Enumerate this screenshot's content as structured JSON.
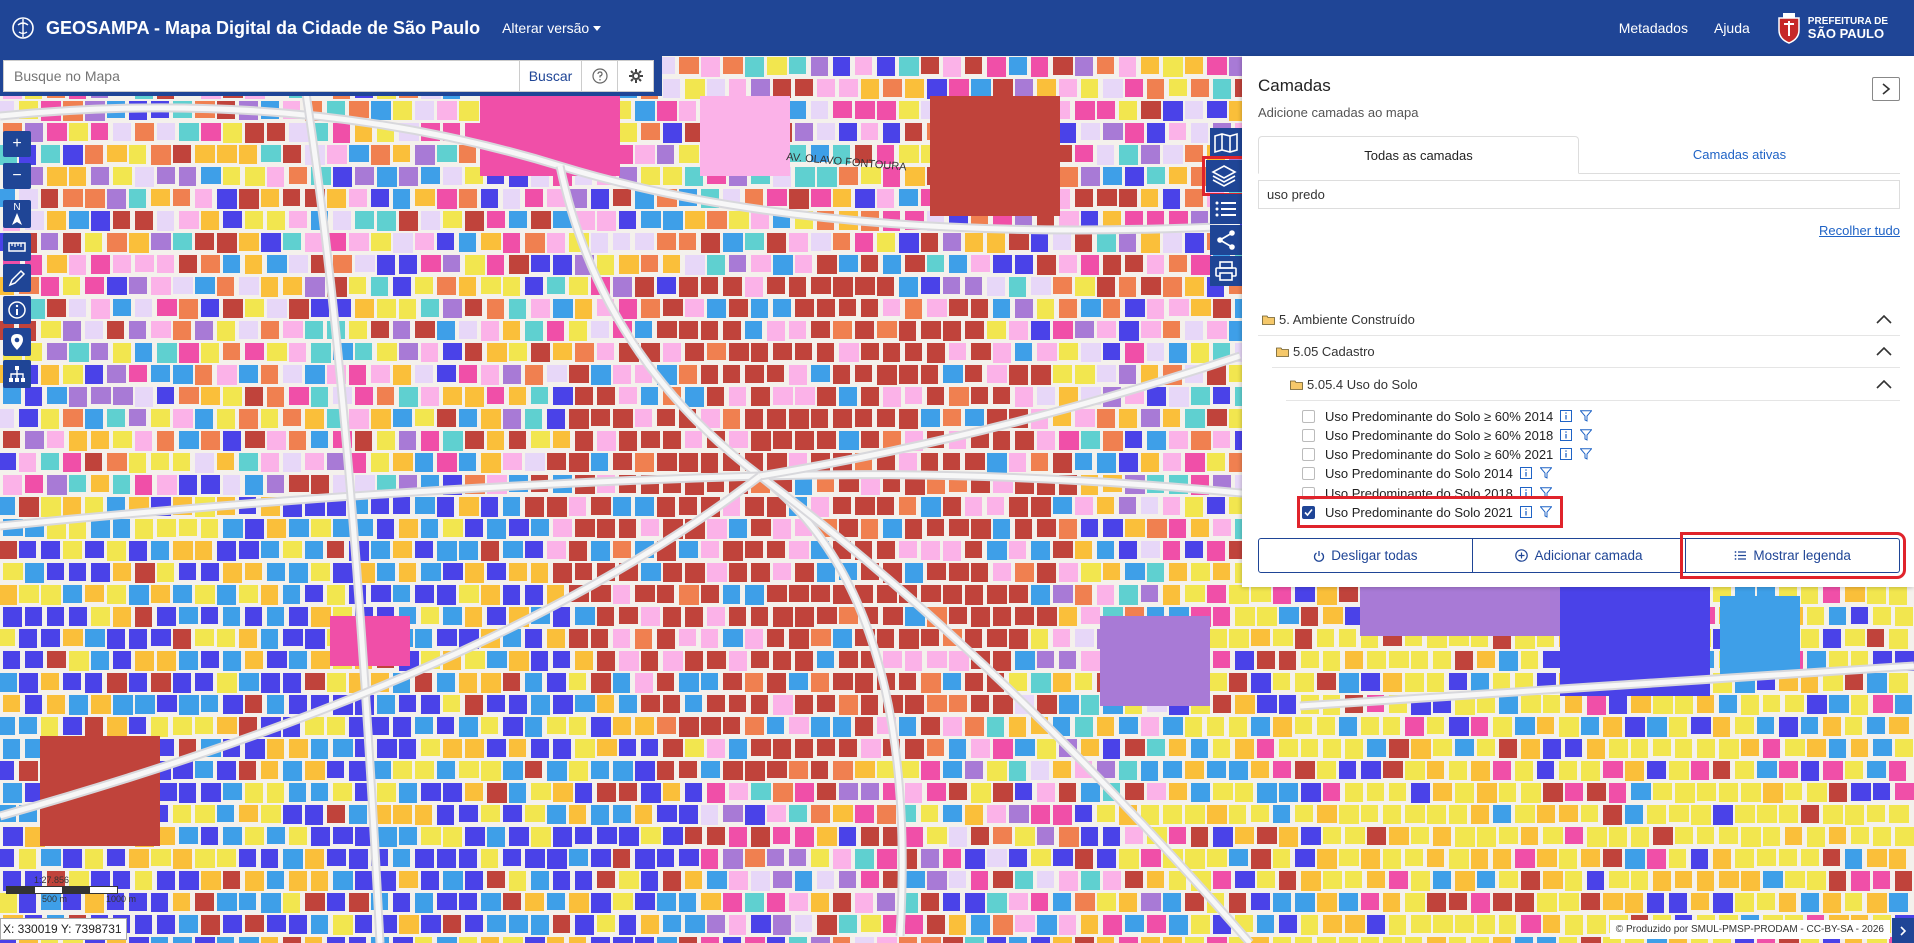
{
  "header": {
    "title": "GEOSAMPA - Mapa Digital da Cidade de São Paulo",
    "version_label": "Alterar versão",
    "nav": [
      "Metadados",
      "Ajuda"
    ],
    "prefeitura_line1": "PREFEITURA DE",
    "prefeitura_line2": "SÃO PAULO"
  },
  "search": {
    "placeholder": "Busque no Mapa",
    "button_label": "Buscar"
  },
  "map_tools": {
    "zoom_in": "+",
    "zoom_out": "−",
    "north": "N"
  },
  "map_labels": [
    "AV. OLAVO FONTOURA"
  ],
  "panel": {
    "title": "Camadas",
    "subtitle": "Adicione camadas ao mapa",
    "tabs": [
      "Todas as camadas",
      "Camadas ativas"
    ],
    "filter_value": "uso predo",
    "collapse_all": "Recolher tudo",
    "tree": [
      {
        "label": "5. Ambiente Construído"
      },
      {
        "label": "5.05 Cadastro"
      },
      {
        "label": "5.05.4 Uso do Solo"
      }
    ],
    "layers": [
      {
        "label": "Uso Predominante do Solo ≥ 60% 2014",
        "checked": false
      },
      {
        "label": "Uso Predominante do Solo ≥ 60% 2018",
        "checked": false
      },
      {
        "label": "Uso Predominante do Solo ≥ 60% 2021",
        "checked": false
      },
      {
        "label": "Uso Predominante do Solo 2014",
        "checked": false
      },
      {
        "label": "Uso Predominante do Solo 2018",
        "checked": false
      },
      {
        "label": "Uso Predominante do Solo 2021",
        "checked": true
      }
    ],
    "actions": [
      "Desligar todas",
      "Adicionar camada",
      "Mostrar legenda"
    ]
  },
  "scale": {
    "ratio": "1:27.856",
    "left_tick": "500 m",
    "right_tick": "1000 m"
  },
  "coords": "X: 330019 Y: 7398731",
  "credits": "© Produzido por SMUL-PMSP-PRODAM - CC-BY-SA - 2026",
  "colors": {
    "brand": "#1f4596",
    "highlight": "#e0232b",
    "link": "#1f63c6",
    "map_palette": [
      "#f2e64f",
      "#fabf3a",
      "#c0433b",
      "#3e9fe8",
      "#4a42e8",
      "#f04fa8",
      "#fbb2e8",
      "#f08050",
      "#a87ad6",
      "#e7d7f8",
      "#5fd0d0"
    ]
  }
}
